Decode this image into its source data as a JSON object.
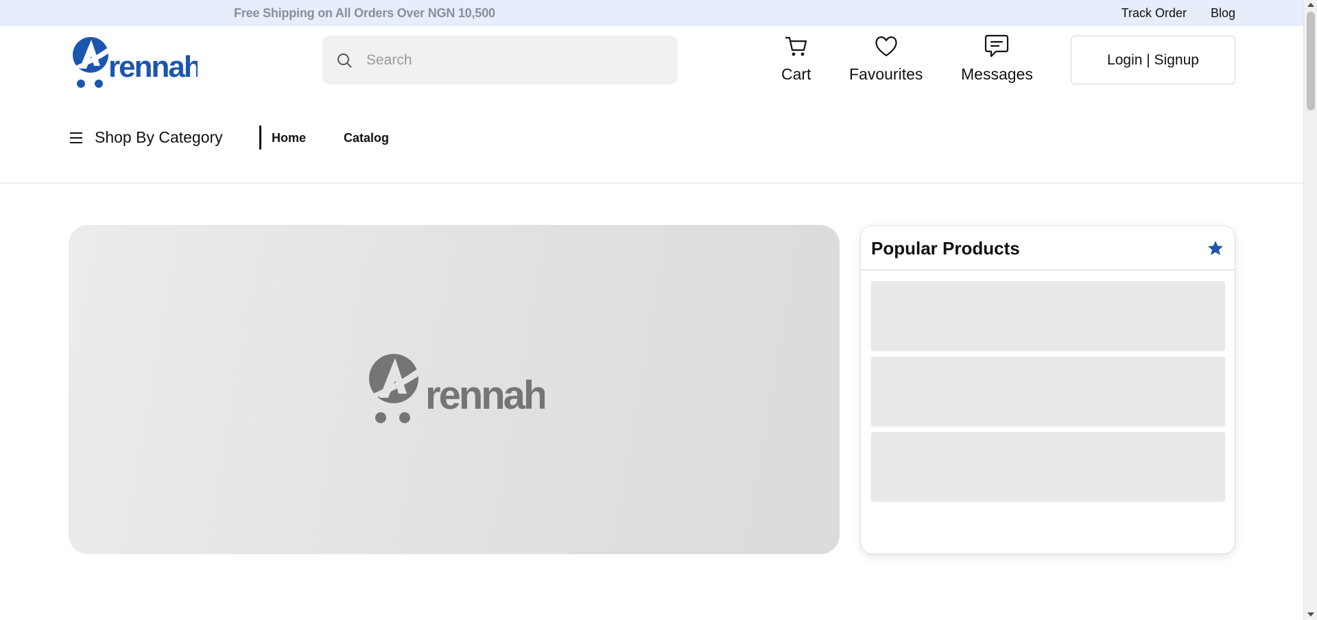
{
  "announcement": {
    "shipping_text": "Free Shipping on All Orders Over NGN 10,500",
    "links": [
      "Track Order",
      "Blog"
    ]
  },
  "header": {
    "logo_text": "rennah",
    "search_placeholder": "Search",
    "search_value": "",
    "actions": {
      "cart": "Cart",
      "favourites": "Favourites",
      "messages": "Messages"
    },
    "login_label": "Login | Signup"
  },
  "nav": {
    "category_label": "Shop By Category",
    "links": [
      "Home",
      "Catalog"
    ]
  },
  "hero": {
    "placeholder_logo_text": "rennah"
  },
  "popular": {
    "title": "Popular Products",
    "skeleton_items": 3
  },
  "colors": {
    "brand_blue": "#1a56b0",
    "announcement_bg": "#e6edfb",
    "hero_logo_gray": "#757575",
    "skeleton": "#e8e8e8"
  },
  "icons": {
    "search": "search-icon",
    "cart": "cart-icon",
    "favourites": "heart-icon",
    "messages": "message-icon",
    "menu": "hamburger-icon",
    "popular": "star-icon"
  }
}
